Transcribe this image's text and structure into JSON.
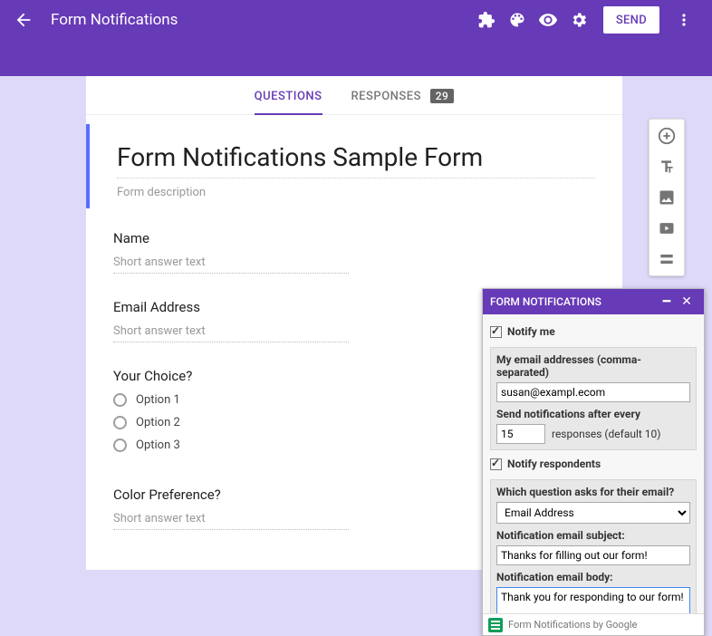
{
  "header": {
    "title": "Form Notifications",
    "sendLabel": "SEND"
  },
  "tabs": {
    "questions": "QUESTIONS",
    "responses": "RESPONSES",
    "responsesBadge": "29"
  },
  "form": {
    "title": "Form Notifications Sample Form",
    "descriptionPlaceholder": "Form description",
    "questions": [
      {
        "label": "Name",
        "shortAnswerPlaceholder": "Short answer text"
      },
      {
        "label": "Email Address",
        "shortAnswerPlaceholder": "Short answer text"
      },
      {
        "label": "Your Choice?",
        "options": [
          "Option 1",
          "Option 2",
          "Option 3"
        ]
      },
      {
        "label": "Color Preference?",
        "shortAnswerPlaceholder": "Short answer text"
      }
    ]
  },
  "addon": {
    "title": "FORM NOTIFICATIONS",
    "notifyMe": "Notify me",
    "myEmailsLabel": "My email addresses (comma-separated)",
    "myEmailsValue": "susan@exampl.ecom",
    "sendAfterLabel": "Send notifications after every",
    "sendAfterValue": "15",
    "sendAfterSuffix": "responses (default 10)",
    "notifyRespondents": "Notify respondents",
    "whichQuestionLabel": "Which question asks for their email?",
    "whichQuestionValue": "Email Address",
    "subjectLabel": "Notification email subject:",
    "subjectValue": "Thanks for filling out our form!",
    "bodyLabel": "Notification email body:",
    "bodyValue": "Thank you for responding to our form!",
    "footer": "Form Notifications by Google"
  }
}
